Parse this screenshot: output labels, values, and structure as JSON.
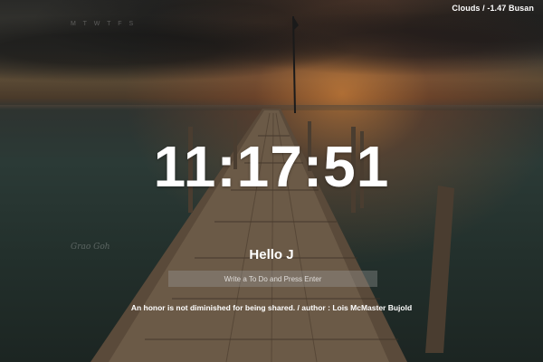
{
  "weather": {
    "condition": "Clouds",
    "separator": "/",
    "temperature": "-1.47",
    "city": "Busan"
  },
  "calendar": {
    "weekdays": "M T W T F S"
  },
  "clock": {
    "time": "11:17:51"
  },
  "greeting": {
    "text": "Hello J"
  },
  "todo": {
    "placeholder": "Write a To Do and Press Enter",
    "value": ""
  },
  "quote": {
    "text": "An honor is not diminished for being shared.",
    "separator": "/",
    "author_prefix": "author :",
    "author": "Lois McMaster Bujold"
  }
}
